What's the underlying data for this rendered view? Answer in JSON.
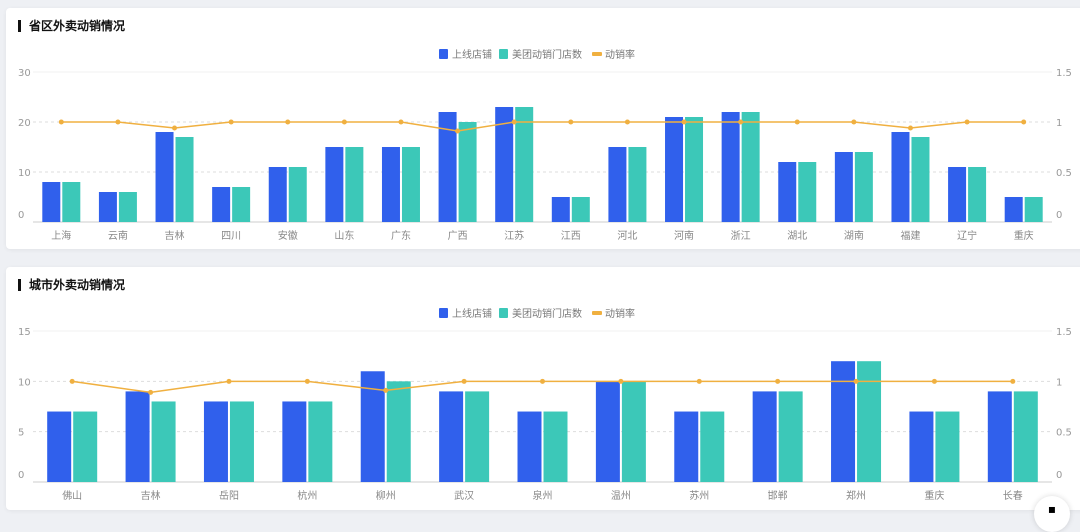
{
  "chart_data": [
    {
      "type": "bar",
      "title": "省区外卖动销情况",
      "legend": [
        "上线店铺",
        "美团动销门店数",
        "动销率"
      ],
      "legend_position": "top-center",
      "categories": [
        "上海",
        "云南",
        "吉林",
        "四川",
        "安徽",
        "山东",
        "广东",
        "广西",
        "江苏",
        "江西",
        "河北",
        "河南",
        "浙江",
        "湖北",
        "湖南",
        "福建",
        "辽宁",
        "重庆"
      ],
      "series": [
        {
          "name": "上线店铺",
          "type": "bar",
          "axis": "left",
          "values": [
            8,
            6,
            18,
            7,
            11,
            15,
            15,
            22,
            23,
            5,
            15,
            21,
            22,
            12,
            14,
            18,
            11,
            5
          ]
        },
        {
          "name": "美团动销门店数",
          "type": "bar",
          "axis": "left",
          "values": [
            8,
            6,
            17,
            7,
            11,
            15,
            15,
            20,
            23,
            5,
            15,
            21,
            22,
            12,
            14,
            17,
            11,
            5
          ]
        },
        {
          "name": "动销率",
          "type": "line",
          "axis": "right",
          "values": [
            1,
            1,
            0.94,
            1,
            1,
            1,
            1,
            0.91,
            1,
            1,
            1,
            1,
            1,
            1,
            1,
            0.94,
            1,
            1
          ]
        }
      ],
      "ylim": [
        0,
        30
      ],
      "yticks": [
        "0",
        "10",
        "20",
        "30"
      ],
      "y2lim": [
        0,
        1.5
      ],
      "y2ticks": [
        "0",
        "0.5",
        "1",
        "1.5"
      ],
      "grid": true
    },
    {
      "type": "bar",
      "title": "城市外卖动销情况",
      "legend": [
        "上线店铺",
        "美团动销门店数",
        "动销率"
      ],
      "legend_position": "top-center",
      "categories": [
        "佛山",
        "吉林",
        "岳阳",
        "杭州",
        "柳州",
        "武汉",
        "泉州",
        "温州",
        "苏州",
        "邯郸",
        "郑州",
        "重庆",
        "长春"
      ],
      "series": [
        {
          "name": "上线店铺",
          "type": "bar",
          "axis": "left",
          "values": [
            7,
            9,
            8,
            8,
            11,
            9,
            7,
            10,
            7,
            9,
            12,
            7,
            9
          ]
        },
        {
          "name": "美团动销门店数",
          "type": "bar",
          "axis": "left",
          "values": [
            7,
            8,
            8,
            8,
            10,
            9,
            7,
            10,
            7,
            9,
            12,
            7,
            9
          ]
        },
        {
          "name": "动销率",
          "type": "line",
          "axis": "right",
          "values": [
            1,
            0.89,
            1,
            1,
            0.91,
            1,
            1,
            1,
            1,
            1,
            1,
            1,
            1
          ]
        }
      ],
      "ylim": [
        0,
        15
      ],
      "yticks": [
        "0",
        "5",
        "10",
        "15"
      ],
      "y2lim": [
        0,
        1.5
      ],
      "y2ticks": [
        "0",
        "0.5",
        "1",
        "1.5"
      ],
      "grid": true
    }
  ],
  "colors": {
    "bar1": "#3060ec",
    "bar2": "#3cc8b8",
    "line": "#f0b040"
  }
}
